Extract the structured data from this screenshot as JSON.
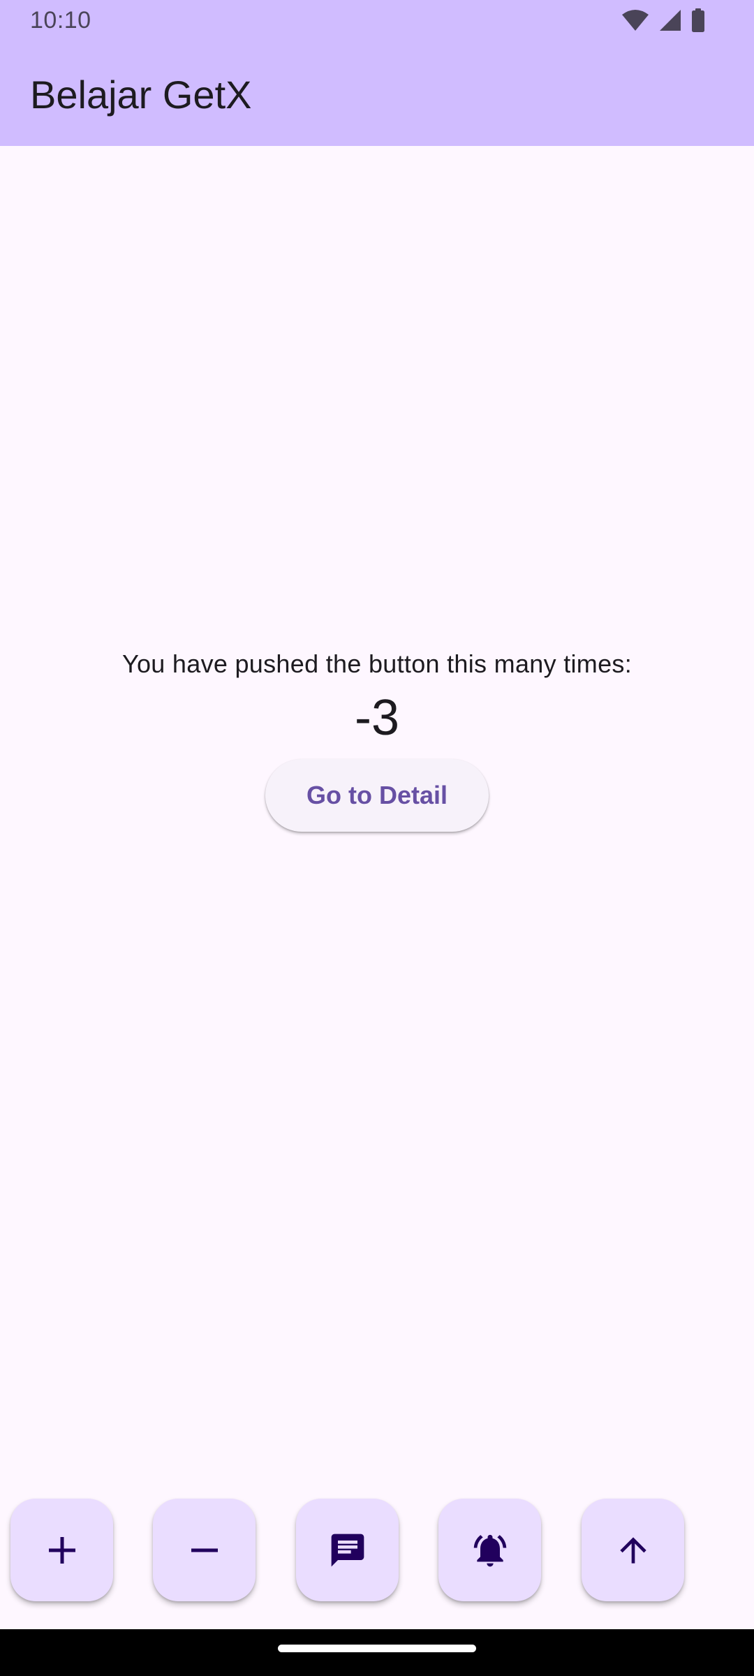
{
  "status_bar": {
    "time": "10:10",
    "icons": [
      "wifi-icon",
      "cellular-signal-icon",
      "battery-icon"
    ]
  },
  "app_bar": {
    "title": "Belajar GetX"
  },
  "main": {
    "message": "You have pushed the button this many times:",
    "counter": "-3",
    "detail_button_label": "Go to Detail"
  },
  "fabs": [
    {
      "icon": "add-icon"
    },
    {
      "icon": "remove-icon"
    },
    {
      "icon": "message-icon"
    },
    {
      "icon": "notification-ring-icon"
    },
    {
      "icon": "arrow-upward-icon"
    }
  ],
  "colors": {
    "app_bar": "#D0BCFF",
    "background": "#FEF7FF",
    "fab": "#EADDFF",
    "fab_icon": "#21005D",
    "accent_text": "#6750A4"
  }
}
